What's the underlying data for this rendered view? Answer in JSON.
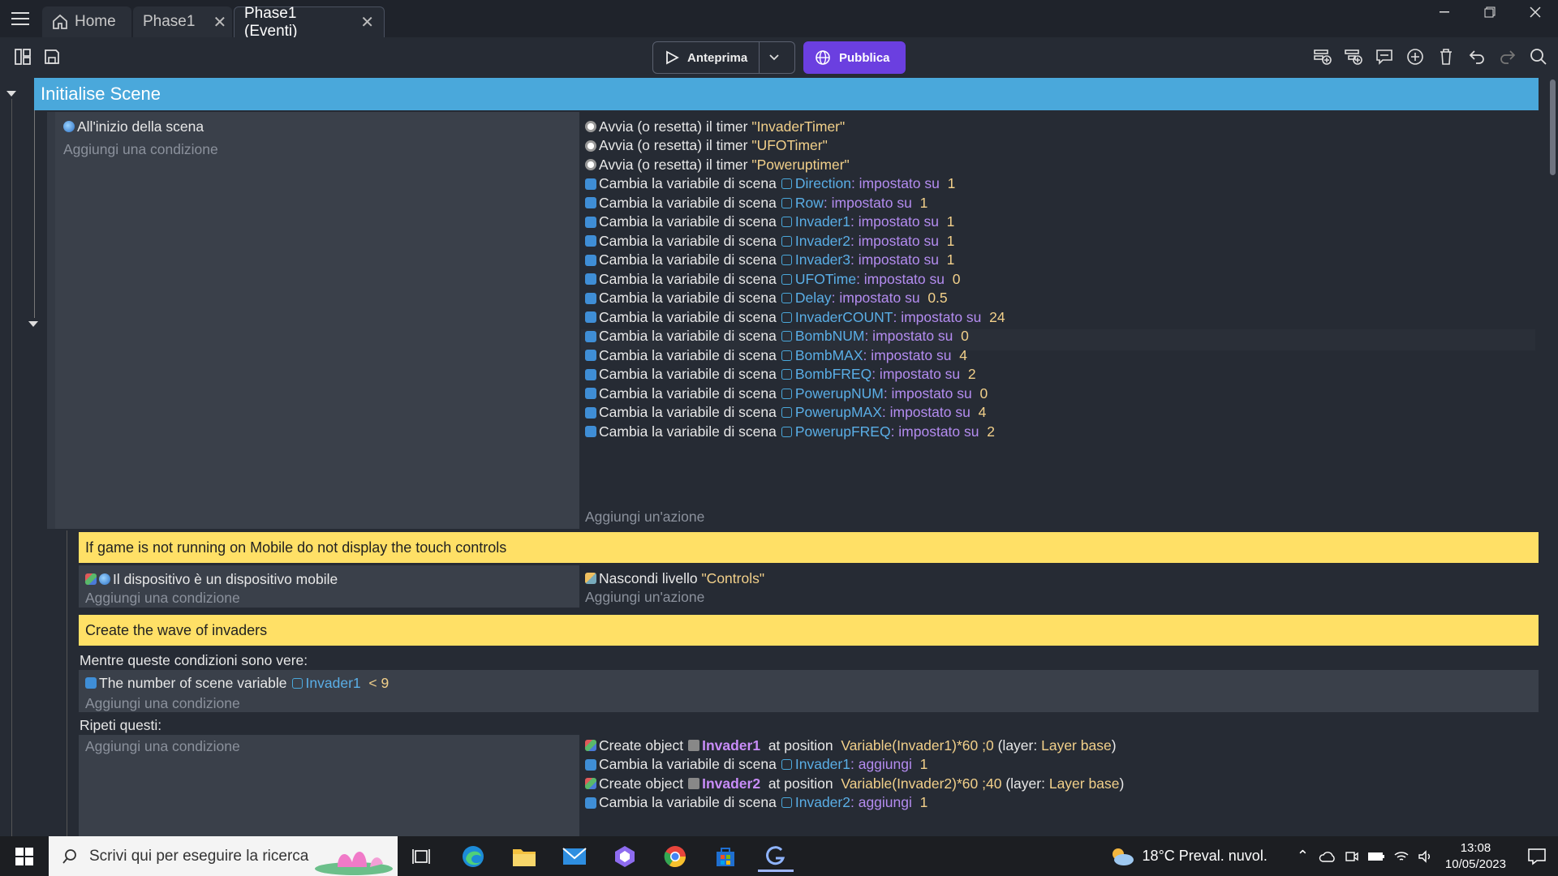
{
  "tabs": [
    {
      "label": "Home"
    },
    {
      "label": "Phase1"
    },
    {
      "label": "Phase1 (Eventi)"
    }
  ],
  "toolbar": {
    "preview_label": "Anteprima",
    "publish_label": "Pubblica"
  },
  "group": {
    "title": "Initialise Scene"
  },
  "event1": {
    "condition": "All'inizio della scena",
    "add_condition": "Aggiungi una condizione",
    "add_action": "Aggiungi un'azione",
    "actions": [
      {
        "prefix": "Avvia (o resetta) il timer",
        "arg": "\"InvaderTimer\""
      },
      {
        "prefix": "Avvia (o resetta) il timer",
        "arg": "\"UFOTimer\""
      },
      {
        "prefix": "Avvia (o resetta) il timer",
        "arg": "\"Poweruptimer\""
      },
      {
        "prefix": "Cambia la variabile di scena",
        "var": "Direction",
        "op": ": impostato su",
        "val": "1"
      },
      {
        "prefix": "Cambia la variabile di scena",
        "var": "Row",
        "op": ": impostato su",
        "val": "1"
      },
      {
        "prefix": "Cambia la variabile di scena",
        "var": "Invader1",
        "op": ": impostato su",
        "val": "1"
      },
      {
        "prefix": "Cambia la variabile di scena",
        "var": "Invader2",
        "op": ": impostato su",
        "val": "1"
      },
      {
        "prefix": "Cambia la variabile di scena",
        "var": "Invader3",
        "op": ": impostato su",
        "val": "1"
      },
      {
        "prefix": "Cambia la variabile di scena",
        "var": "UFOTime",
        "op": ": impostato su",
        "val": "0"
      },
      {
        "prefix": "Cambia la variabile di scena",
        "var": "Delay",
        "op": ": impostato su",
        "val": "0.5"
      },
      {
        "prefix": "Cambia la variabile di scena",
        "var": "InvaderCOUNT",
        "op": ": impostato su",
        "val": "24"
      },
      {
        "prefix": "Cambia la variabile di scena",
        "var": "BombNUM",
        "op": ": impostato su",
        "val": "0"
      },
      {
        "prefix": "Cambia la variabile di scena",
        "var": "BombMAX",
        "op": ": impostato su",
        "val": "4"
      },
      {
        "prefix": "Cambia la variabile di scena",
        "var": "BombFREQ",
        "op": ": impostato su",
        "val": "2"
      },
      {
        "prefix": "Cambia la variabile di scena",
        "var": "PowerupNUM",
        "op": ": impostato su",
        "val": "0"
      },
      {
        "prefix": "Cambia la variabile di scena",
        "var": "PowerupMAX",
        "op": ": impostato su",
        "val": "4"
      },
      {
        "prefix": "Cambia la variabile di scena",
        "var": "PowerupFREQ",
        "op": ": impostato su",
        "val": "2"
      }
    ]
  },
  "comment1": "If game is not running on Mobile do not display the touch controls",
  "event2": {
    "condition": "Il dispositivo è un dispositivo mobile",
    "add_condition": "Aggiungi una condizione",
    "action_prefix": "Nascondi livello",
    "action_arg": "\"Controls\"",
    "add_action": "Aggiungi un'azione"
  },
  "comment2": "Create the wave of invaders",
  "while": {
    "header": "Mentre queste condizioni sono vere:",
    "cond_prefix": "The number of scene variable",
    "cond_var": "Invader1",
    "cond_op": "< 9",
    "add_condition": "Aggiungi una condizione",
    "repeat_header": "Ripeti questi:",
    "repeat_add_condition": "Aggiungi una condizione",
    "actions": [
      {
        "kind": "create",
        "prefix": "Create object",
        "obj": "Invader1",
        "mid": "at position",
        "expr": "Variable(Invader1)*60 ;0",
        "layer_pre": "(layer:",
        "layer": "Layer base",
        "layer_post": ")"
      },
      {
        "kind": "var",
        "prefix": "Cambia la variabile di scena",
        "var": "Invader1",
        "op": ": aggiungi",
        "val": "1"
      },
      {
        "kind": "create",
        "prefix": "Create object",
        "obj": "Invader2",
        "mid": "at position",
        "expr": "Variable(Invader2)*60 ;40",
        "layer_pre": "(layer:",
        "layer": "Layer base",
        "layer_post": ")"
      },
      {
        "kind": "var",
        "prefix": "Cambia la variabile di scena",
        "var": "Invader2",
        "op": ": aggiungi",
        "val": "1"
      }
    ]
  },
  "taskbar": {
    "search_placeholder": "Scrivi qui per eseguire la ricerca",
    "weather": "18°C  Preval. nuvol.",
    "time": "13:08",
    "date": "10/05/2023"
  }
}
